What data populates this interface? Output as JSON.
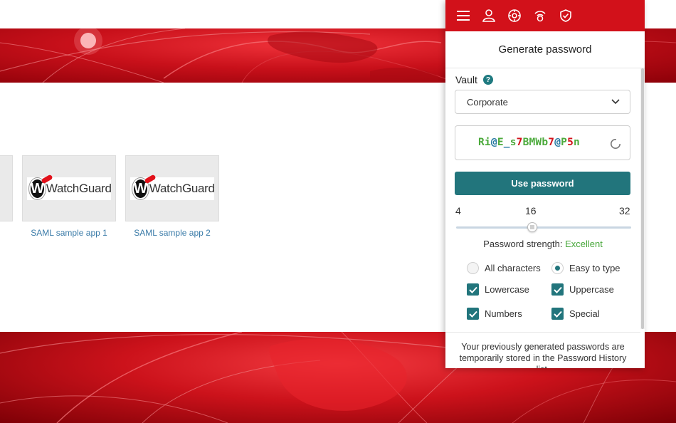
{
  "colors": {
    "brand_red": "#d2111a",
    "accent_teal": "#22757c",
    "strength_good": "#49a83c",
    "link_blue": "#3a7ba8"
  },
  "apps": [
    {
      "label": "SAML sample app 1",
      "logo_text": "WatchGuard"
    },
    {
      "label": "SAML sample app 2",
      "logo_text": "WatchGuard"
    }
  ],
  "popup": {
    "toolbar_icons": [
      "menu-icon",
      "user-icon",
      "vault-icon",
      "wifi-icon",
      "shield-icon"
    ],
    "title": "Generate password",
    "vault": {
      "label": "Vault",
      "help": "?",
      "selected": "Corporate"
    },
    "password": {
      "segments": [
        {
          "text": "Ri",
          "color": "#4caa3c"
        },
        {
          "text": "@",
          "color": "#2277a0"
        },
        {
          "text": "E",
          "color": "#4caa3c"
        },
        {
          "text": "_",
          "color": "#2277a0"
        },
        {
          "text": "s",
          "color": "#4caa3c"
        },
        {
          "text": "7",
          "color": "#d2111a"
        },
        {
          "text": "BMWb",
          "color": "#4caa3c"
        },
        {
          "text": "7",
          "color": "#d2111a"
        },
        {
          "text": "@",
          "color": "#2277a0"
        },
        {
          "text": "P",
          "color": "#4caa3c"
        },
        {
          "text": "5",
          "color": "#d2111a"
        },
        {
          "text": "n",
          "color": "#4caa3c"
        }
      ]
    },
    "use_button": "Use password",
    "length": {
      "min": "4",
      "current": "16",
      "max": "32",
      "value": 16
    },
    "strength_label": "Password strength:",
    "strength_value": "Excellent",
    "options": {
      "all_characters": {
        "label": "All characters",
        "selected": false
      },
      "easy_to_type": {
        "label": "Easy to type",
        "selected": true
      },
      "lowercase": {
        "label": "Lowercase",
        "checked": true
      },
      "uppercase": {
        "label": "Uppercase",
        "checked": true
      },
      "numbers": {
        "label": "Numbers",
        "checked": true
      },
      "special": {
        "label": "Special",
        "checked": true
      }
    },
    "history_note": "Your previously generated passwords are temporarily stored in the Password History list."
  }
}
